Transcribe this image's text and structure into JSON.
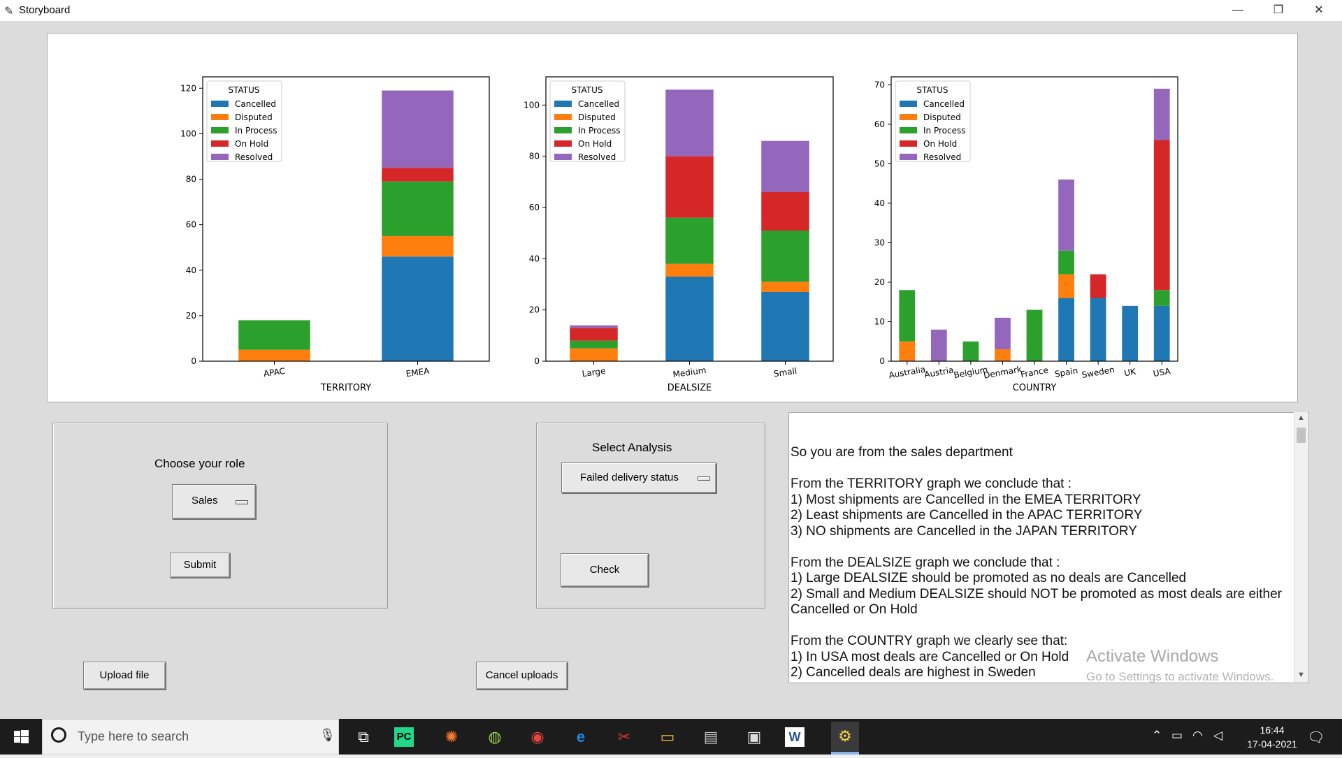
{
  "window": {
    "title": "Storyboard",
    "controls": {
      "minimize": "—",
      "maximize": "❐",
      "close": "✕"
    }
  },
  "charts": {
    "status_title": "STATUS",
    "status_labels": [
      "Cancelled",
      "Disputed",
      "In Process",
      "On Hold",
      "Resolved"
    ],
    "status_colors": [
      "#1f77b4",
      "#ff7f0e",
      "#2ca02c",
      "#d62728",
      "#9467bd"
    ]
  },
  "chart_data": [
    {
      "type": "bar",
      "stacked": true,
      "xlabel": "TERRITORY",
      "categories": [
        "APAC",
        "EMEA"
      ],
      "ylim": [
        0,
        125
      ],
      "yticks": [
        0,
        20,
        40,
        60,
        80,
        100,
        120
      ],
      "legend": "upper-left",
      "series": [
        {
          "name": "Cancelled",
          "values": [
            0,
            46
          ]
        },
        {
          "name": "Disputed",
          "values": [
            5,
            9
          ]
        },
        {
          "name": "In Process",
          "values": [
            13,
            24
          ]
        },
        {
          "name": "On Hold",
          "values": [
            0,
            6
          ]
        },
        {
          "name": "Resolved",
          "values": [
            0,
            34
          ]
        }
      ]
    },
    {
      "type": "bar",
      "stacked": true,
      "xlabel": "DEALSIZE",
      "categories": [
        "Large",
        "Medium",
        "Small"
      ],
      "ylim": [
        0,
        111
      ],
      "yticks": [
        0,
        20,
        40,
        60,
        80,
        100
      ],
      "legend": "upper-left",
      "series": [
        {
          "name": "Cancelled",
          "values": [
            0,
            33,
            27
          ]
        },
        {
          "name": "Disputed",
          "values": [
            5,
            5,
            4
          ]
        },
        {
          "name": "In Process",
          "values": [
            3,
            18,
            20
          ]
        },
        {
          "name": "On Hold",
          "values": [
            5,
            24,
            15
          ]
        },
        {
          "name": "Resolved",
          "values": [
            1,
            26,
            20
          ]
        }
      ]
    },
    {
      "type": "bar",
      "stacked": true,
      "xlabel": "COUNTRY",
      "categories": [
        "Australia",
        "Austria",
        "Belgium",
        "Denmark",
        "France",
        "Spain",
        "Sweden",
        "UK",
        "USA"
      ],
      "ylim": [
        0,
        72
      ],
      "yticks": [
        0,
        10,
        20,
        30,
        40,
        50,
        60,
        70
      ],
      "legend": "upper-left",
      "series": [
        {
          "name": "Cancelled",
          "values": [
            0,
            0,
            0,
            0,
            0,
            16,
            16,
            14,
            14
          ]
        },
        {
          "name": "Disputed",
          "values": [
            5,
            0,
            0,
            3,
            0,
            6,
            0,
            0,
            0
          ]
        },
        {
          "name": "In Process",
          "values": [
            13,
            0,
            5,
            0,
            13,
            6,
            0,
            0,
            4
          ]
        },
        {
          "name": "On Hold",
          "values": [
            0,
            0,
            0,
            0,
            0,
            0,
            6,
            0,
            38
          ]
        },
        {
          "name": "Resolved",
          "values": [
            0,
            8,
            0,
            8,
            0,
            18,
            0,
            0,
            13
          ]
        }
      ]
    }
  ],
  "role_panel": {
    "label": "Choose your role",
    "selected_role": "Sales",
    "submit_label": "Submit"
  },
  "analysis_panel": {
    "label": "Select Analysis",
    "selected_analysis": "Failed delivery status",
    "check_label": "Check"
  },
  "buttons": {
    "upload": "Upload file",
    "cancel_uploads": "Cancel uploads"
  },
  "output_text": [
    "So you are from the sales department",
    "",
    "From the TERRITORY graph we conclude that :",
    "1) Most shipments are Cancelled in the EMEA TERRITORY",
    "2) Least shipments are Cancelled in the APAC TERRITORY",
    "3) NO shipments are Cancelled in the JAPAN TERRITORY",
    "",
    "From the DEALSIZE graph we conclude that :",
    "1) Large DEALSIZE should be promoted as no deals are Cancelled",
    "2) Small and Medium DEALSIZE should NOT be promoted as most deals are either Cancelled or On Hold",
    "",
    "From the COUNTRY graph we clearly see that:",
    "1) In USA most deals are Cancelled or On Hold",
    "2) Cancelled deals are highest in Sweden"
  ],
  "watermark": {
    "line1": "Activate Windows",
    "line2": "Go to Settings to activate Windows."
  },
  "taskbar": {
    "search_placeholder": "Type here to search",
    "time": "16:44",
    "date": "17-04-2021"
  }
}
